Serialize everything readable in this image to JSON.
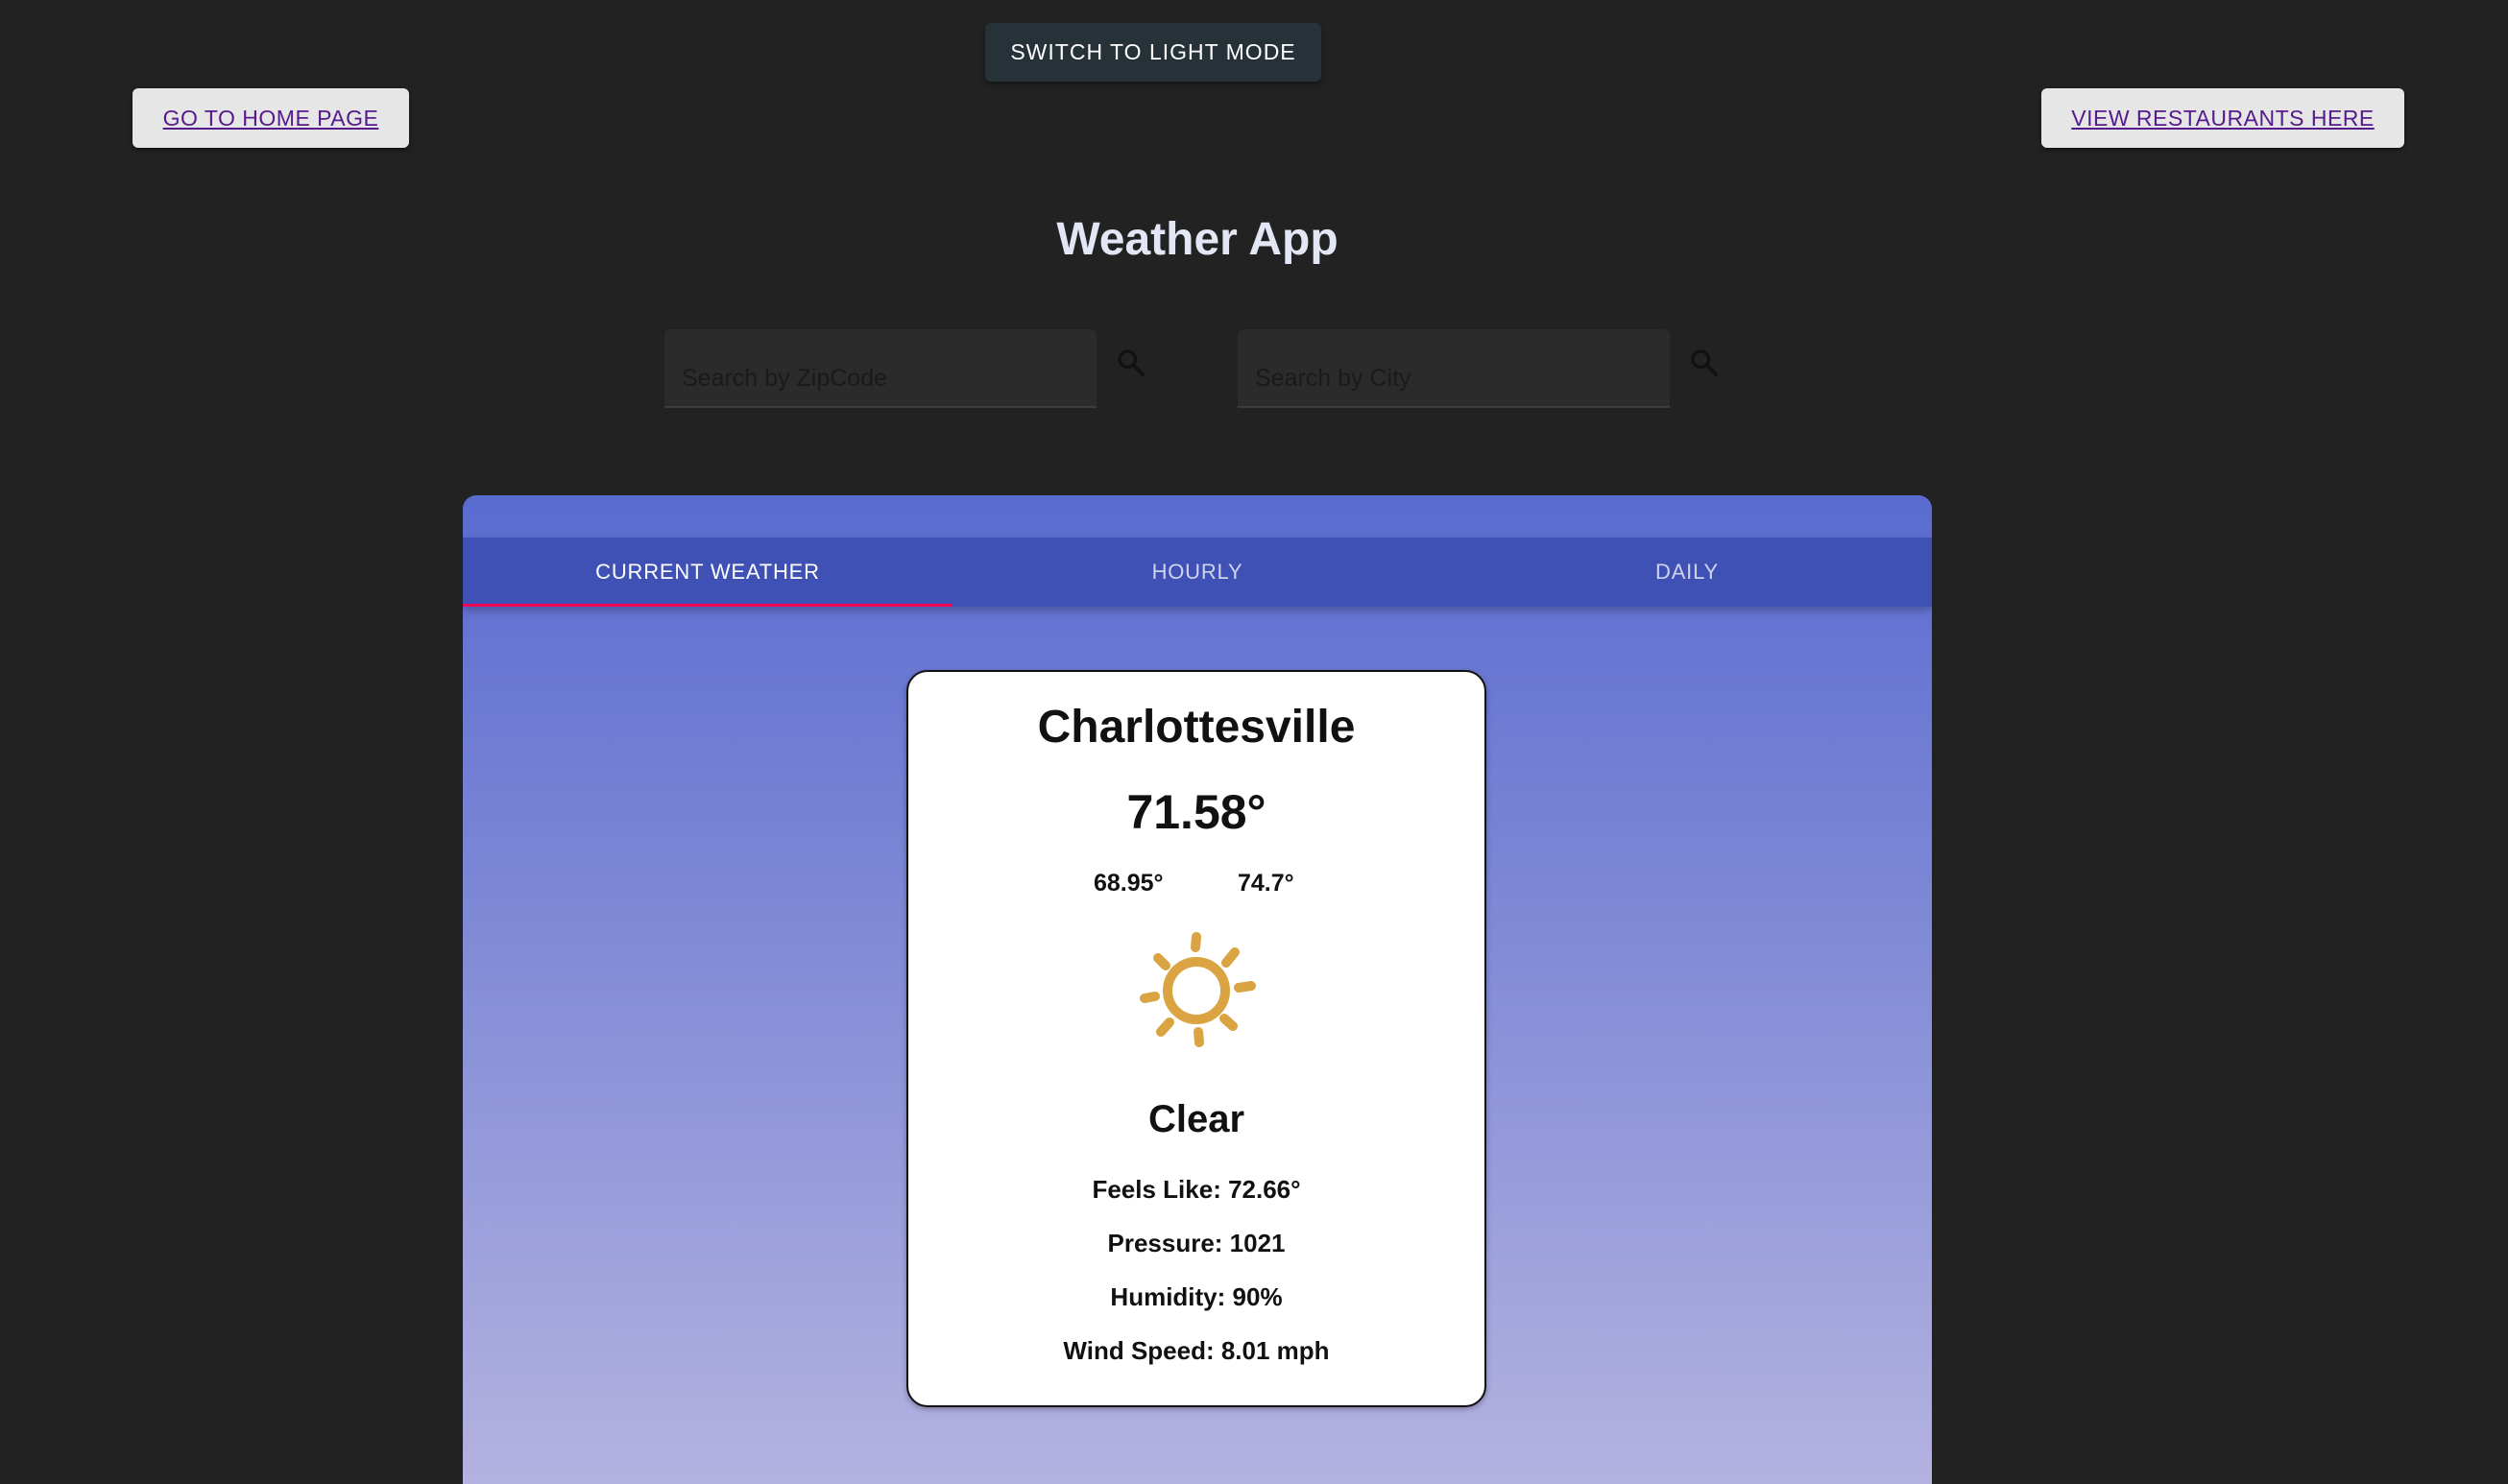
{
  "header": {
    "mode_toggle_label": "SWITCH TO LIGHT MODE",
    "home_link_label": "GO TO HOME PAGE",
    "restaurants_link_label": "VIEW RESTAURANTS HERE",
    "app_title": "Weather App"
  },
  "search": {
    "zip_placeholder": "Search by ZipCode",
    "city_placeholder": "Search by City",
    "zip_value": "",
    "city_value": "",
    "icon": "search-icon"
  },
  "tabs": [
    {
      "label": "CURRENT WEATHER",
      "active": true
    },
    {
      "label": "HOURLY",
      "active": false
    },
    {
      "label": "DAILY",
      "active": false
    }
  ],
  "weather": {
    "city": "Charlottesville",
    "temperature": "71.58°",
    "low": "68.95°",
    "high": "74.7°",
    "condition_icon": "sun-icon",
    "condition": "Clear",
    "feels_like": "Feels Like: 72.66°",
    "pressure": "Pressure: 1021",
    "humidity": "Humidity: 90%",
    "wind_speed": "Wind Speed: 8.01 mph"
  },
  "colors": {
    "page_background": "#222222",
    "tab_bar": "#3f51b5",
    "tab_indicator": "#f50057",
    "sun": "#d9a441",
    "link": "#551a8b"
  }
}
